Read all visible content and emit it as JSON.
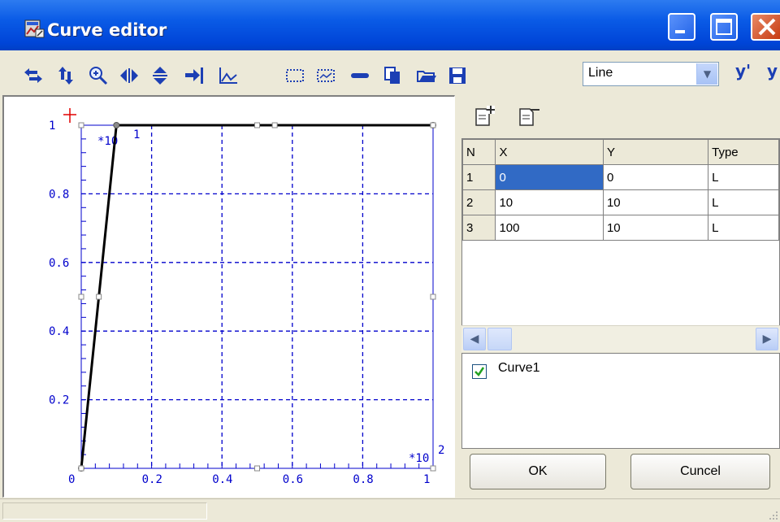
{
  "window": {
    "title": "Curve editor"
  },
  "toolbar": {
    "tools": [
      "scroll-horizontal-icon",
      "scroll-vertical-icon",
      "zoom-icon",
      "expand-horizontal-icon",
      "expand-vertical-icon",
      "fit-right-icon",
      "chart-axes-icon",
      "select-rect-icon",
      "select-area-icon",
      "line-tool-icon",
      "copy-icon",
      "open-folder-icon",
      "save-icon",
      "y-derivative-icon"
    ],
    "mode_select": {
      "value": "Line"
    },
    "y_prime_label": "y'"
  },
  "chart": {
    "x_multiplier": "*10",
    "x_exponent": "2",
    "y_multiplier": "*10",
    "y_exponent": "1",
    "x_ticks": [
      "0",
      "0.2",
      "0.4",
      "0.6",
      "0.8",
      "1"
    ],
    "y_ticks": [
      "0.2",
      "0.4",
      "0.6",
      "0.8",
      "1"
    ],
    "line_color": "#000000",
    "axis_color": "#0000cc"
  },
  "chart_data": {
    "type": "line",
    "x": [
      0,
      10,
      100
    ],
    "y": [
      0,
      10,
      10
    ],
    "xlim": [
      0,
      100
    ],
    "ylim": [
      0,
      10
    ],
    "grid": true
  },
  "points_table": {
    "columns": [
      "N",
      "X",
      "Y",
      "Type"
    ],
    "rows": [
      {
        "n": "1",
        "x": "0",
        "y": "0",
        "type": "L"
      },
      {
        "n": "2",
        "x": "10",
        "y": "10",
        "type": "L"
      },
      {
        "n": "3",
        "x": "100",
        "y": "10",
        "type": "L"
      }
    ]
  },
  "curves": [
    {
      "name": "Curve1",
      "checked": true
    }
  ],
  "buttons": {
    "ok": "OK",
    "cancel": "Cuncel"
  }
}
